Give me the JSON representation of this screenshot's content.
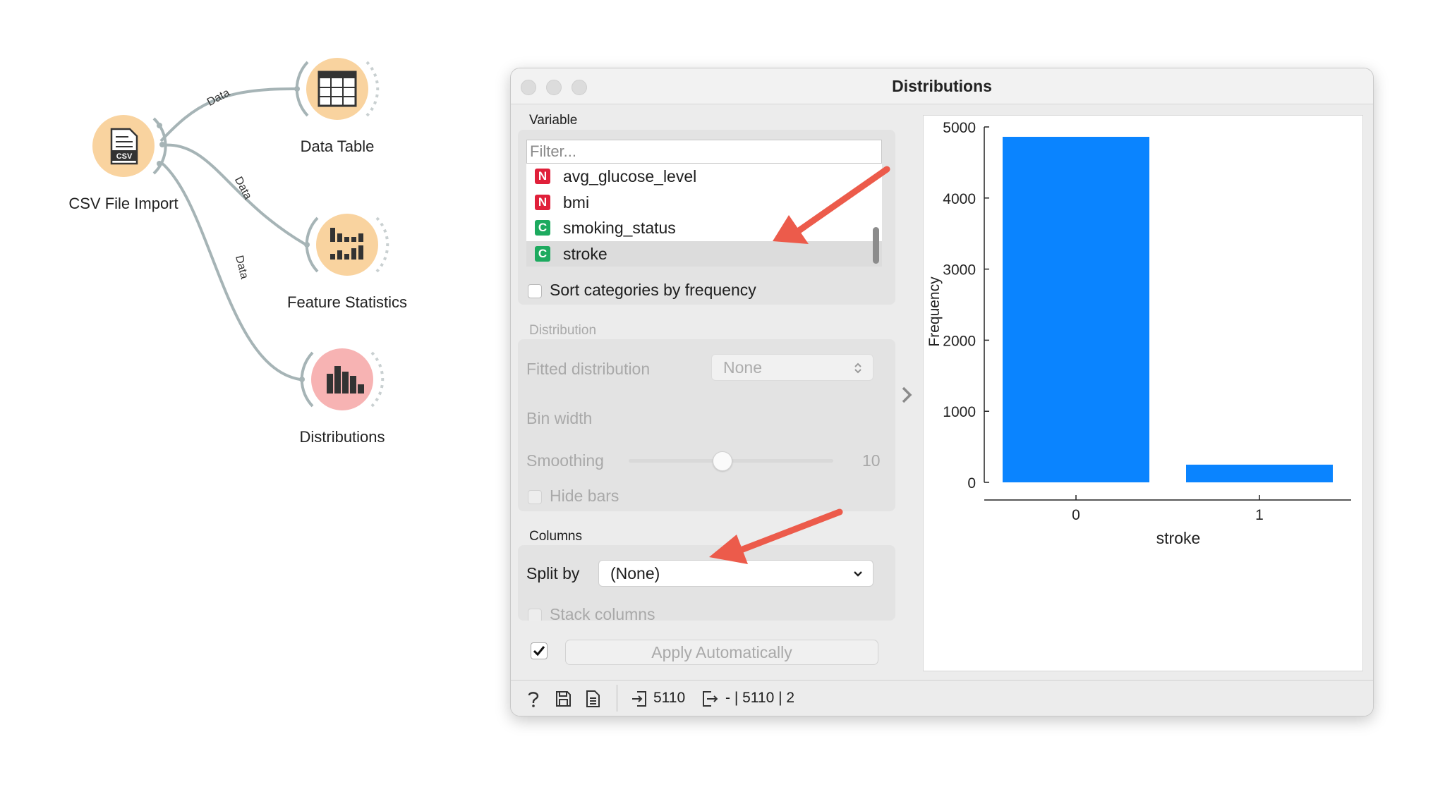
{
  "workflow": {
    "nodes": [
      {
        "id": "csv",
        "label": "CSV File Import",
        "icon": "csv-file-icon",
        "color": "#f9d39f"
      },
      {
        "id": "table",
        "label": "Data Table",
        "icon": "table-grid-icon",
        "color": "#f9d39f"
      },
      {
        "id": "stats",
        "label": "Feature Statistics",
        "icon": "feature-statistics-icon",
        "color": "#f9d39f"
      },
      {
        "id": "dist",
        "label": "Distributions",
        "icon": "bar-chart-icon",
        "color": "#f7b3b3"
      }
    ],
    "links": [
      {
        "from": "csv",
        "to": "table",
        "label": "Data"
      },
      {
        "from": "csv",
        "to": "stats",
        "label": "Data"
      },
      {
        "from": "csv",
        "to": "dist",
        "label": "Data"
      }
    ]
  },
  "window": {
    "title": "Distributions",
    "variable": {
      "section_title": "Variable",
      "filter_placeholder": "Filter...",
      "items": [
        {
          "type": "N",
          "name": "avg_glucose_level",
          "color": "#e0203a",
          "selected": false
        },
        {
          "type": "N",
          "name": "bmi",
          "color": "#e0203a",
          "selected": false
        },
        {
          "type": "C",
          "name": "smoking_status",
          "color": "#1daa5f",
          "selected": false
        },
        {
          "type": "C",
          "name": "stroke",
          "color": "#1daa5f",
          "selected": true
        }
      ],
      "sort_label": "Sort categories by frequency",
      "sort_checked": false
    },
    "distribution": {
      "section_title": "Distribution",
      "fitted_label": "Fitted distribution",
      "fitted_value": "None",
      "bin_width_label": "Bin width",
      "smoothing_label": "Smoothing",
      "smoothing_value": "10",
      "hide_bars_label": "Hide bars"
    },
    "columns": {
      "section_title": "Columns",
      "split_label": "Split by",
      "split_value": "(None)",
      "stack_label": "Stack columns"
    },
    "apply": {
      "label": "Apply Automatically",
      "checked": true
    },
    "status": {
      "input_count": "5110",
      "output_text": "- | 5110 | 2"
    }
  },
  "chart_data": {
    "type": "bar",
    "categories": [
      "0",
      "1"
    ],
    "values": [
      4861,
      249
    ],
    "xlabel": "stroke",
    "ylabel": "Frequency",
    "ylim": [
      0,
      5000
    ],
    "yticks": [
      0,
      1000,
      2000,
      3000,
      4000,
      5000
    ],
    "bar_color": "#0a84ff",
    "grid": false
  }
}
